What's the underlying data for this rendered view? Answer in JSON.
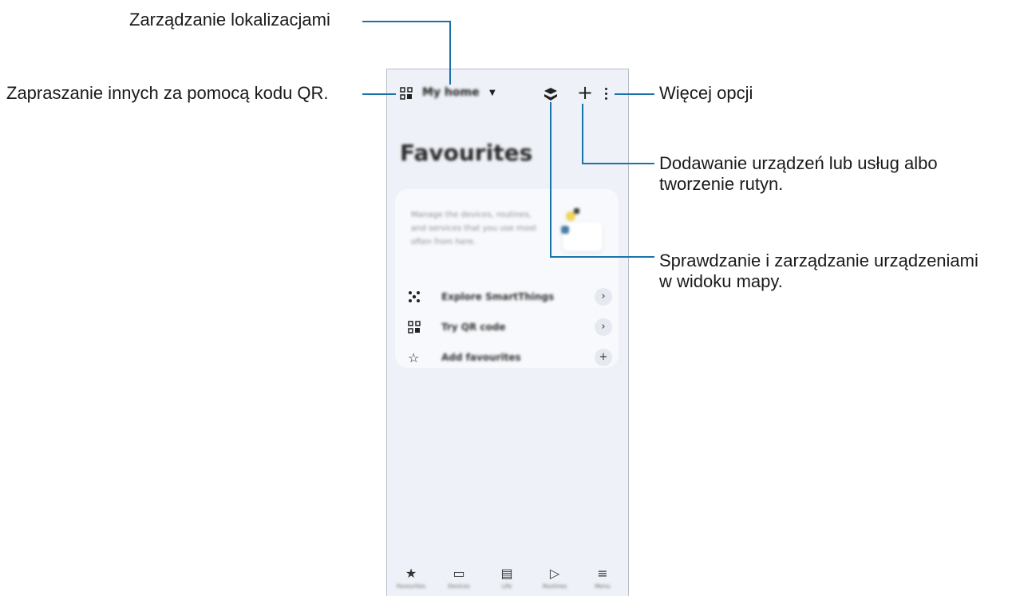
{
  "app": {
    "home_name": "My home",
    "page_title": "Favourites",
    "card_description": "Manage the devices, routines, and services that you use most often from here.",
    "rows": [
      {
        "label": "Explore SmartThings",
        "action": "›"
      },
      {
        "label": "Try QR code",
        "action": "›"
      },
      {
        "label": "Add favourites",
        "action": "+"
      }
    ],
    "nav": [
      {
        "label": "Favourites",
        "icon": "★"
      },
      {
        "label": "Devices",
        "icon": "▭"
      },
      {
        "label": "Life",
        "icon": "▤"
      },
      {
        "label": "Routines",
        "icon": "▷"
      },
      {
        "label": "Menu",
        "icon": "≡"
      }
    ]
  },
  "callouts": {
    "manage_locations": "Zarządzanie lokalizacjami",
    "invite_qr": "Zapraszanie innych za pomocą kodu QR.",
    "more_options": "Więcej opcji",
    "add_devices_line1": "Dodawanie urządzeń lub usług albo",
    "add_devices_line2": "tworzenie rutyn.",
    "map_view_line1": "Sprawdzanie i zarządzanie urządzeniami",
    "map_view_line2": "w widoku mapy."
  },
  "colors": {
    "leader_line": "#1a73a8",
    "phone_bg": "#eef1f7"
  }
}
